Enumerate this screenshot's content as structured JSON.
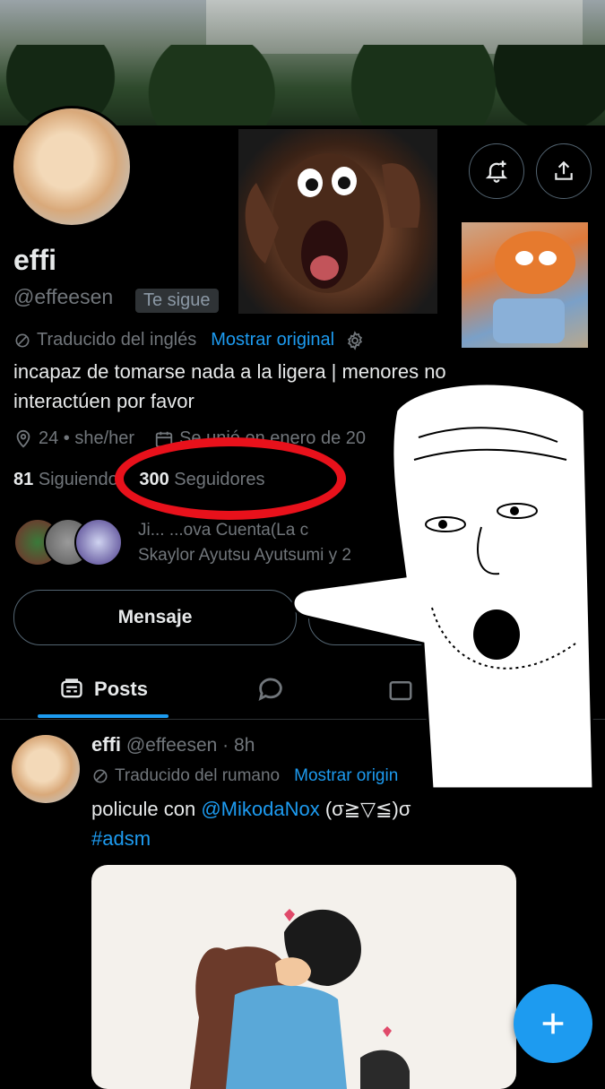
{
  "profile": {
    "name": "effi",
    "handle": "@effeesen",
    "follows_you": "Te sigue",
    "translated_label": "Traducido del inglés",
    "show_original": "Mostrar original",
    "bio_line1": "incapaz de tomarse nada a la ligera | menores no",
    "bio_line2": "interactúen por favor",
    "age_pronouns": "24 • she/her",
    "joined": "Se unió en enero de 20",
    "following_count": "81",
    "following_label": "Siguiendo",
    "followers_count": "300",
    "followers_label": "Seguidores",
    "followed_by_line1": "Ji... ...ova Cuenta(La c",
    "followed_by_line2": "Skaylor Ayutsu Ayutsumi y 2",
    "message_button": "Mensaje"
  },
  "tabs": {
    "posts": "Posts"
  },
  "post": {
    "author": "effi",
    "handle_time": "@effeesen · 8h",
    "translated_label": "Traducido del rumano",
    "show_original": "Mostrar origin",
    "text_before": "policule con ",
    "mention": "@MikodaNox",
    "text_after": " (σ≧▽≦)σ",
    "hashtag": "#adsm"
  },
  "colors": {
    "accent": "#1d9bf0",
    "circle": "#e8111b"
  }
}
